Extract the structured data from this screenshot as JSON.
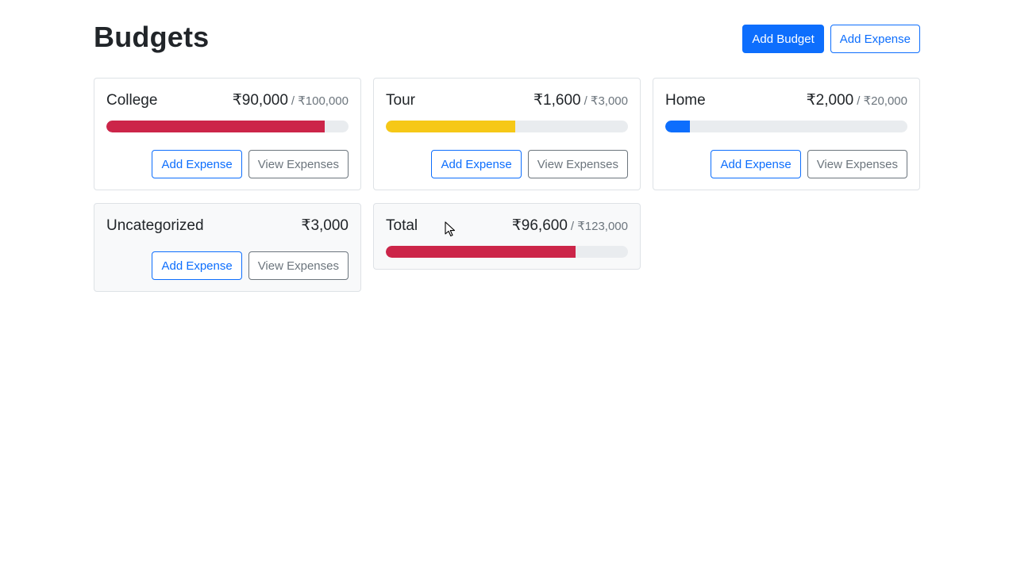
{
  "header": {
    "title": "Budgets",
    "add_budget_label": "Add Budget",
    "add_expense_label": "Add Expense"
  },
  "cards": [
    {
      "name": "College",
      "amount": "₹90,000",
      "max": "/ ₹100,000",
      "progress": 0.9,
      "bar_color": "#cc2549",
      "add_label": "Add Expense",
      "view_label": "View Expenses"
    },
    {
      "name": "Tour",
      "amount": "₹1,600",
      "max": "/ ₹3,000",
      "progress": 0.533,
      "bar_color": "#f6c817",
      "add_label": "Add Expense",
      "view_label": "View Expenses"
    },
    {
      "name": "Home",
      "amount": "₹2,000",
      "max": "/ ₹20,000",
      "progress": 0.1,
      "bar_color": "#0d6efd",
      "add_label": "Add Expense",
      "view_label": "View Expenses"
    },
    {
      "name": "Uncategorized",
      "amount": "₹3,000",
      "add_label": "Add Expense",
      "view_label": "View Expenses"
    },
    {
      "name": "Total",
      "amount": "₹96,600",
      "max": "/ ₹123,000",
      "progress": 0.785,
      "bar_color": "#cc2549"
    }
  ]
}
